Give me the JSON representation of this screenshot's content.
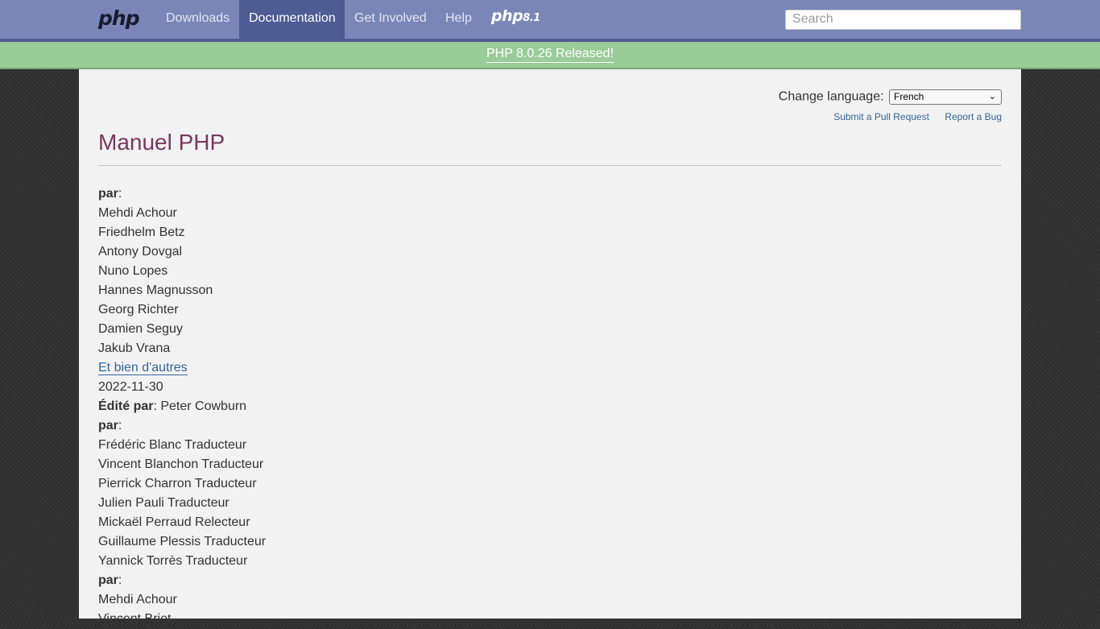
{
  "nav": {
    "logo": "php",
    "items": [
      "Downloads",
      "Documentation",
      "Get Involved",
      "Help"
    ],
    "version_logo": "php",
    "version_num": "8.1",
    "search_placeholder": "Search"
  },
  "banner": {
    "text": "PHP 8.0.26 Released!"
  },
  "page": {
    "change_language_label": "Change language:",
    "language_selected": "French",
    "submit_pr": "Submit a Pull Request",
    "report_bug": "Report a Bug",
    "title": "Manuel PHP"
  },
  "credits": {
    "par1": "par",
    "authors": [
      "Mehdi Achour",
      "Friedhelm Betz",
      "Antony Dovgal",
      "Nuno Lopes",
      "Hannes Magnusson",
      "Georg Richter",
      "Damien Seguy",
      "Jakub Vrana"
    ],
    "more_link": "Et bien d'autres",
    "date": "2022-11-30",
    "edited_label": "Édité par",
    "editor": "Peter Cowburn",
    "par2": "par",
    "translators": [
      "Frédéric Blanc Traducteur",
      "Vincent Blanchon Traducteur",
      "Pierrick Charron Traducteur",
      "Julien Pauli Traducteur",
      "Mickaël Perraud Relecteur",
      "Guillaume Plessis Traducteur",
      "Yannick Torrès Traducteur"
    ],
    "par3": "par",
    "more_authors": [
      "Mehdi Achour",
      "Vincent Briet"
    ]
  }
}
